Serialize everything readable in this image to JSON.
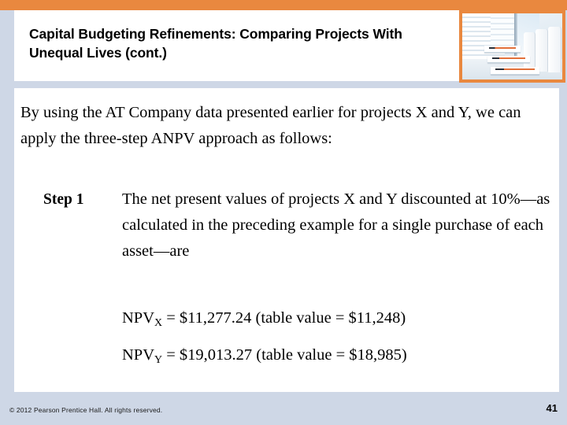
{
  "theme": {
    "accent_orange": "#e9883f",
    "background_blue_gray": "#ced7e6",
    "panel_white": "#ffffff",
    "text_black": "#000000"
  },
  "header": {
    "title": "Capital Budgeting Refinements: Comparing Projects With Unequal Lives (cont.)",
    "thumbnail_alt": "office-interior-photo"
  },
  "main": {
    "intro_paragraph": "By using the AT Company data presented earlier for projects X and Y, we can apply the three-step ANPV approach as follows:",
    "step": {
      "label": "Step 1",
      "text": "The net present values of projects X and Y discounted at 10%—as calculated in the preceding example for a single purchase of each asset—are"
    },
    "formulas": [
      {
        "symbol": "NPV",
        "subscript": "X",
        "equals": " = $11,277.24 (table value = $11,248)",
        "full": "NPVX = $11,277.24 (table value = $11,248)"
      },
      {
        "symbol": "NPV",
        "subscript": "Y",
        "equals": " = $19,013.27 (table value = $18,985)",
        "full": "NPVY = $19,013.27 (table value = $18,985)"
      }
    ]
  },
  "footer": {
    "copyright": "© 2012 Pearson Prentice Hall. All rights reserved.",
    "page_number": "41"
  }
}
